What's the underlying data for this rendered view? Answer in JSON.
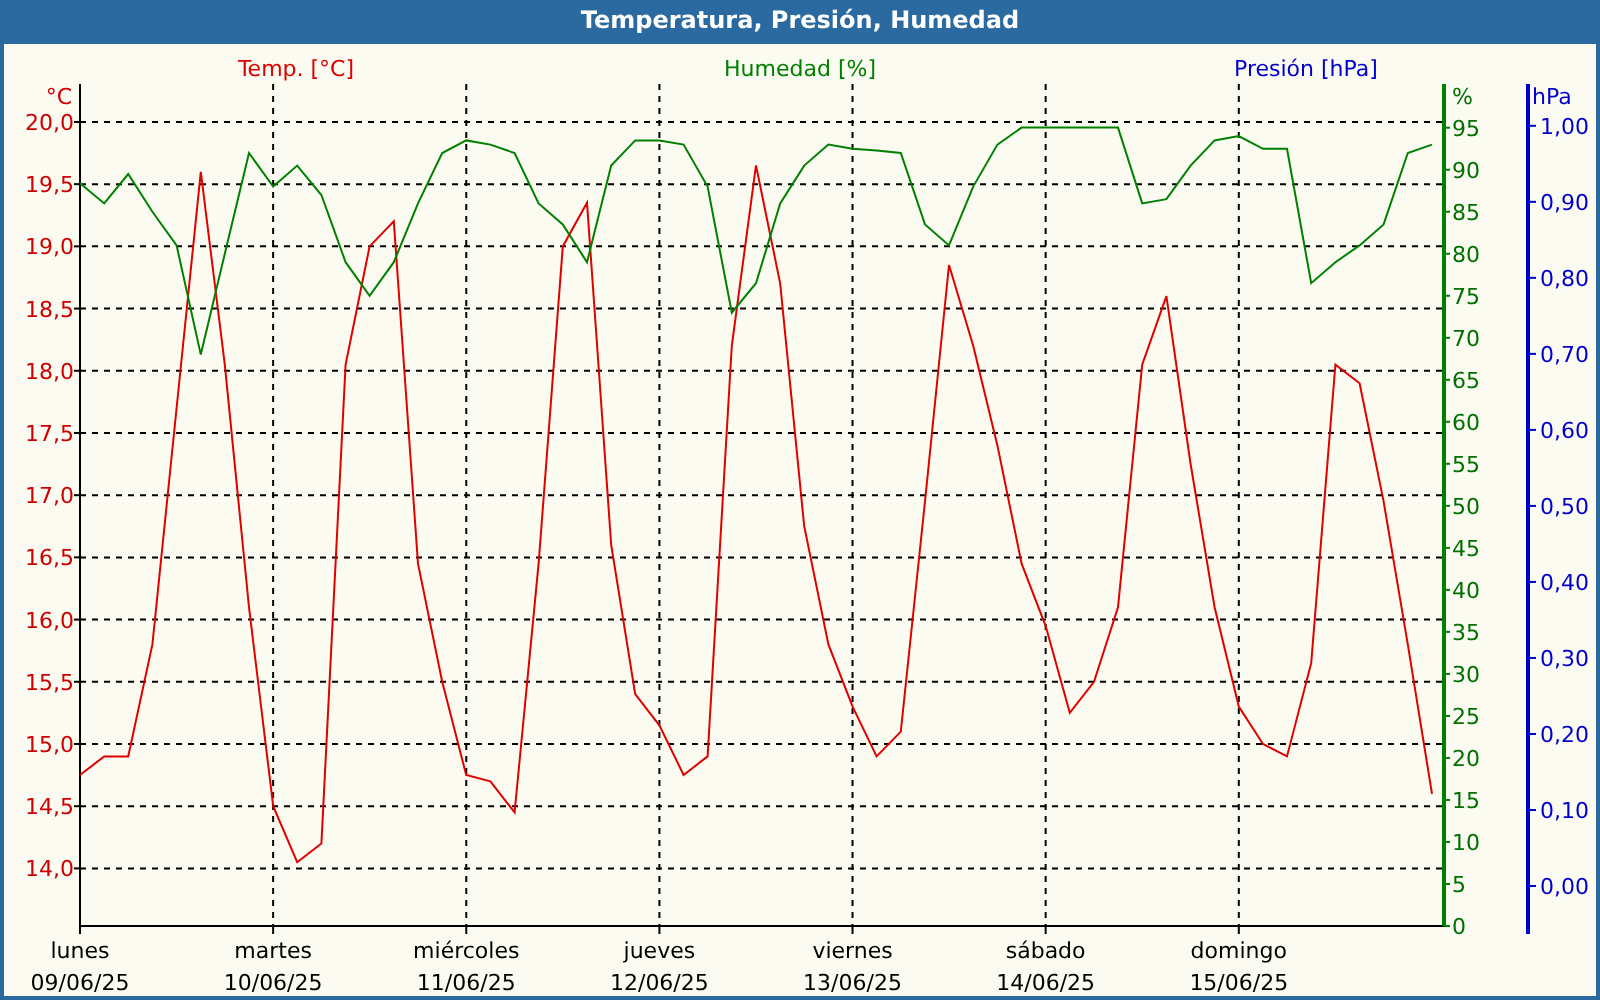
{
  "chart": {
    "date_labels": [
      "09/06/25",
      "10/06/25",
      "11/06/25",
      "12/06/25",
      "13/06/25",
      "14/06/25",
      "15/06/25"
    ],
    "temperature_axis": {
      "unit": "°C"
    },
    "humidity_axis": {
      "unit": "%"
    },
    "pressure_axis": {
      "title": "Presión [hPa]",
      "unit": "hPa"
    },
    "chart_data": {
      "type": "line",
      "title": "Temperatura, Presión, Humedad",
      "grid": true,
      "ylim": [
        13.537,
        20.305
      ],
      "y2lim": [
        0,
        100.2
      ],
      "y3lim": [
        -0.0526,
        1.055
      ],
      "categories": [
        "lunes",
        null,
        null,
        null,
        null,
        null,
        null,
        null,
        "martes",
        null,
        null,
        null,
        null,
        null,
        null,
        null,
        "miércoles",
        null,
        null,
        null,
        null,
        null,
        null,
        null,
        "jueves",
        null,
        null,
        null,
        null,
        null,
        null,
        null,
        "viernes",
        null,
        null,
        null,
        null,
        null,
        null,
        null,
        "sábado",
        null,
        null,
        null,
        null,
        null,
        null,
        null,
        "domingo",
        null,
        null,
        null,
        null,
        null,
        null,
        null,
        null
      ],
      "yticks": [
        {
          "value": 14,
          "label": "14,0"
        },
        {
          "value": 14.5,
          "label": "14,5"
        },
        {
          "value": 15,
          "label": "15,0"
        },
        {
          "value": 15.5,
          "label": "15,5"
        },
        {
          "value": 16,
          "label": "16,0"
        },
        {
          "value": 16.5,
          "label": "16,5"
        },
        {
          "value": 17,
          "label": "17,0"
        },
        {
          "value": 17.5,
          "label": "17,5"
        },
        {
          "value": 18,
          "label": "18,0"
        },
        {
          "value": 18.5,
          "label": "18,5"
        },
        {
          "value": 19,
          "label": "19,0"
        },
        {
          "value": 19.5,
          "label": "19,5"
        },
        {
          "value": 20,
          "label": "20,0"
        }
      ],
      "y2ticks": [
        0,
        5,
        10,
        15,
        20,
        25,
        30,
        35,
        40,
        45,
        50,
        55,
        60,
        65,
        70,
        75,
        80,
        85,
        90,
        95
      ],
      "y3ticks": [
        {
          "value": 0,
          "label": "0,00"
        },
        {
          "value": 0.1,
          "label": "0,10"
        },
        {
          "value": 0.2,
          "label": "0,20"
        },
        {
          "value": 0.3,
          "label": "0,30"
        },
        {
          "value": 0.4,
          "label": "0,40"
        },
        {
          "value": 0.5,
          "label": "0,50"
        },
        {
          "value": 0.6,
          "label": "0,60"
        },
        {
          "value": 0.7,
          "label": "0,70"
        },
        {
          "value": 0.8,
          "label": "0,80"
        },
        {
          "value": 0.9,
          "label": "0,90"
        },
        {
          "value": 1,
          "label": "1,00"
        }
      ],
      "series": [
        {
          "name": "Temp. [°C]",
          "color": "#e00000",
          "axis": "y",
          "values": [
            14.75,
            14.9,
            14.9,
            15.8,
            17.7,
            19.6,
            18.05,
            16.1,
            14.5,
            14.05,
            14.2,
            18.05,
            19.0,
            19.2,
            16.45,
            15.5,
            14.75,
            14.7,
            14.45,
            16.45,
            19.0,
            19.35,
            16.6,
            15.4,
            15.15,
            14.75,
            14.9,
            18.2,
            19.65,
            18.7,
            16.75,
            15.8,
            15.3,
            14.9,
            15.1,
            16.95,
            18.85,
            18.2,
            17.4,
            16.45,
            15.95,
            15.25,
            15.5,
            16.1,
            18.05,
            18.6,
            17.25,
            16.1,
            15.3,
            15.0,
            14.9,
            15.65,
            18.05,
            17.9,
            16.95,
            15.8,
            14.6
          ]
        },
        {
          "name": "Humedad [%]",
          "color": "#008000",
          "axis": "y2",
          "values": [
            88.4,
            86,
            89.5,
            85,
            81,
            68,
            80,
            92,
            88,
            90.5,
            87,
            79,
            75,
            79,
            86,
            92,
            93.5,
            93,
            92,
            86,
            83.5,
            79,
            90.5,
            93.5,
            93.5,
            93,
            88,
            73,
            76.5,
            86,
            90.5,
            93,
            92.5,
            92.3,
            92,
            83.5,
            81,
            88,
            93,
            95,
            95,
            95,
            95,
            95,
            86,
            86.5,
            90.5,
            93.5,
            94,
            92.5,
            92.5,
            76.5,
            79,
            81,
            83.5,
            92,
            93
          ]
        }
      ]
    }
  }
}
